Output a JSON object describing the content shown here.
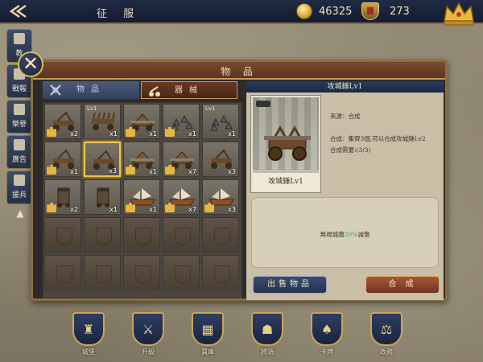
{
  "topbar": {
    "back_label": "",
    "title": "征 服",
    "coins": "46325",
    "crests": "273"
  },
  "sidemenu": {
    "items": [
      {
        "label": "教",
        "icon": "book-icon"
      },
      {
        "label": "戰報",
        "icon": "scroll-icon"
      },
      {
        "label": "榮譽",
        "icon": "trophy-icon"
      },
      {
        "label": "廣告",
        "icon": "film-icon"
      },
      {
        "label": "援兵",
        "icon": "shield-icon"
      }
    ]
  },
  "panel": {
    "title": "物 品",
    "tabs": [
      {
        "label": "物品",
        "active": false
      },
      {
        "label": "器械",
        "active": true
      }
    ]
  },
  "grid": {
    "items": [
      {
        "lv": "",
        "qty": "x2",
        "kind": "catapult",
        "puzzle": true
      },
      {
        "lv": "Lv1",
        "qty": "x1",
        "kind": "spiked",
        "puzzle": false
      },
      {
        "lv": "",
        "qty": "x1",
        "kind": "ram",
        "puzzle": true
      },
      {
        "lv": "",
        "qty": "x1",
        "kind": "caltrops",
        "puzzle": true
      },
      {
        "lv": "Lv1",
        "qty": "x1",
        "kind": "caltrops",
        "puzzle": false
      },
      {
        "lv": "",
        "qty": "x1",
        "kind": "catapult",
        "puzzle": true
      },
      {
        "lv": "",
        "qty": "x3",
        "kind": "catapult",
        "puzzle": false,
        "selected": true
      },
      {
        "lv": "",
        "qty": "x1",
        "kind": "ram",
        "puzzle": true
      },
      {
        "lv": "",
        "qty": "x7",
        "kind": "ram",
        "puzzle": true
      },
      {
        "lv": "",
        "qty": "x3",
        "kind": "catapult",
        "puzzle": false
      },
      {
        "lv": "",
        "qty": "x2",
        "kind": "tower",
        "puzzle": true
      },
      {
        "lv": "",
        "qty": "x1",
        "kind": "tower",
        "puzzle": false
      },
      {
        "lv": "",
        "qty": "x1",
        "kind": "ship",
        "puzzle": true
      },
      {
        "lv": "",
        "qty": "x7",
        "kind": "ship",
        "puzzle": true
      },
      {
        "lv": "",
        "qty": "x3",
        "kind": "ship",
        "puzzle": true
      }
    ],
    "empty_rows": 2
  },
  "detail": {
    "title": "攻城錘Lv1",
    "image_label": "攻城錘Lv1",
    "source": "來源：合成",
    "merge_desc": "合成：集齊3個,可以合成攻城錘Lv2",
    "merge_need": "合成需要:(3/3)",
    "effect_prefix": "無視城牆",
    "effect_pct": "20%",
    "effect_suffix": "減傷",
    "sell_label": "出售物品",
    "merge_label": "合 成"
  },
  "bottom_nav": {
    "items": [
      {
        "label": "城堡",
        "glyph": "♜"
      },
      {
        "label": "升級",
        "glyph": "⚔"
      },
      {
        "label": "寶庫",
        "glyph": "▦"
      },
      {
        "label": "將領",
        "glyph": "☗"
      },
      {
        "label": "卡牌",
        "glyph": "♠"
      },
      {
        "label": "政務",
        "glyph": "⚖"
      }
    ]
  },
  "colors": {
    "accent_gold": "#d9b860",
    "navy": "#1f2a44",
    "effect_green": "#3fa34a"
  }
}
